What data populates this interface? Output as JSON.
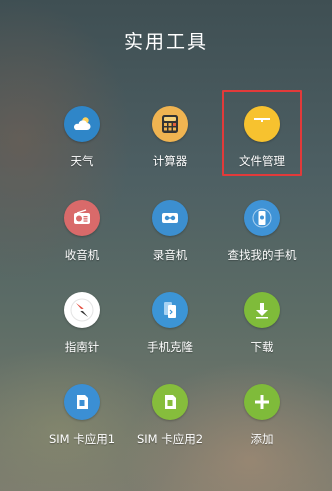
{
  "folder": {
    "title": "实用工具"
  },
  "apps": [
    {
      "label": "天气",
      "icon": "weather-icon",
      "color": "#2f86c8"
    },
    {
      "label": "计算器",
      "icon": "calculator-icon",
      "color": "#f0b451"
    },
    {
      "label": "文件管理",
      "icon": "file-manager-icon",
      "color": "#f7c22f"
    },
    {
      "label": "收音机",
      "icon": "radio-icon",
      "color": "#d96a6a"
    },
    {
      "label": "录音机",
      "icon": "recorder-icon",
      "color": "#3c8fd0"
    },
    {
      "label": "查找我的手机",
      "icon": "find-my-phone-icon",
      "color": "#3f93d6"
    },
    {
      "label": "指南针",
      "icon": "compass-icon",
      "color": "#ffffff"
    },
    {
      "label": "手机克隆",
      "icon": "phone-clone-icon",
      "color": "#3c95d6"
    },
    {
      "label": "下载",
      "icon": "download-icon",
      "color": "#7fbb3a"
    },
    {
      "label": "SIM 卡应用1",
      "icon": "sim-card-1-icon",
      "color": "#3b8fd4"
    },
    {
      "label": "SIM 卡应用2",
      "icon": "sim-card-2-icon",
      "color": "#86bd3c"
    },
    {
      "label": "添加",
      "icon": "add-icon",
      "color": "#7fbb3a"
    }
  ],
  "highlight": {
    "target": "文件管理",
    "color": "#e23a3a"
  }
}
